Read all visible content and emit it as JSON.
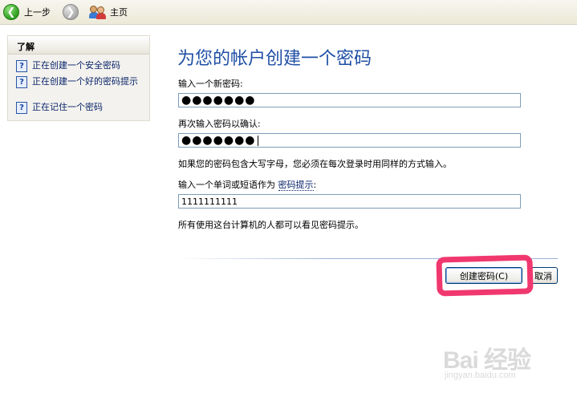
{
  "toolbar": {
    "back_label": "上一步",
    "forward_icon": "forward-arrow-icon",
    "home_label": "主页"
  },
  "learn_panel": {
    "header": "了解",
    "items": [
      {
        "label": "正在创建一个安全密码",
        "icon": "help-icon"
      },
      {
        "label": "正在创建一个好的密码提示",
        "icon": "help-icon"
      },
      {
        "label": "正在记住一个密码",
        "icon": "help-icon"
      }
    ]
  },
  "main": {
    "title": "为您的帐户创建一个密码",
    "new_password_label": "输入一个新密码:",
    "new_password_value": "●●●●●●●",
    "confirm_password_label": "再次输入密码以确认:",
    "confirm_password_value": "●●●●●●●",
    "case_note": "如果您的密码包含大写字母，您必须在每次登录时用同样的方式输入。",
    "hint_label_prefix": "输入一个单词或短语作为",
    "hint_link": "密码提示",
    "hint_label_suffix": ":",
    "hint_value": "1111111111",
    "visibility_note": "所有使用这台计算机的人都可以看见密码提示。"
  },
  "buttons": {
    "create_password": "创建密码(C)",
    "cancel": "取消"
  },
  "colors": {
    "title": "#1f4fa5",
    "annotation": "#f0386f",
    "field_border": "#7f9db9"
  },
  "watermark": {
    "main": "Bai 经验",
    "sub": "jingyan.baidu.com"
  }
}
